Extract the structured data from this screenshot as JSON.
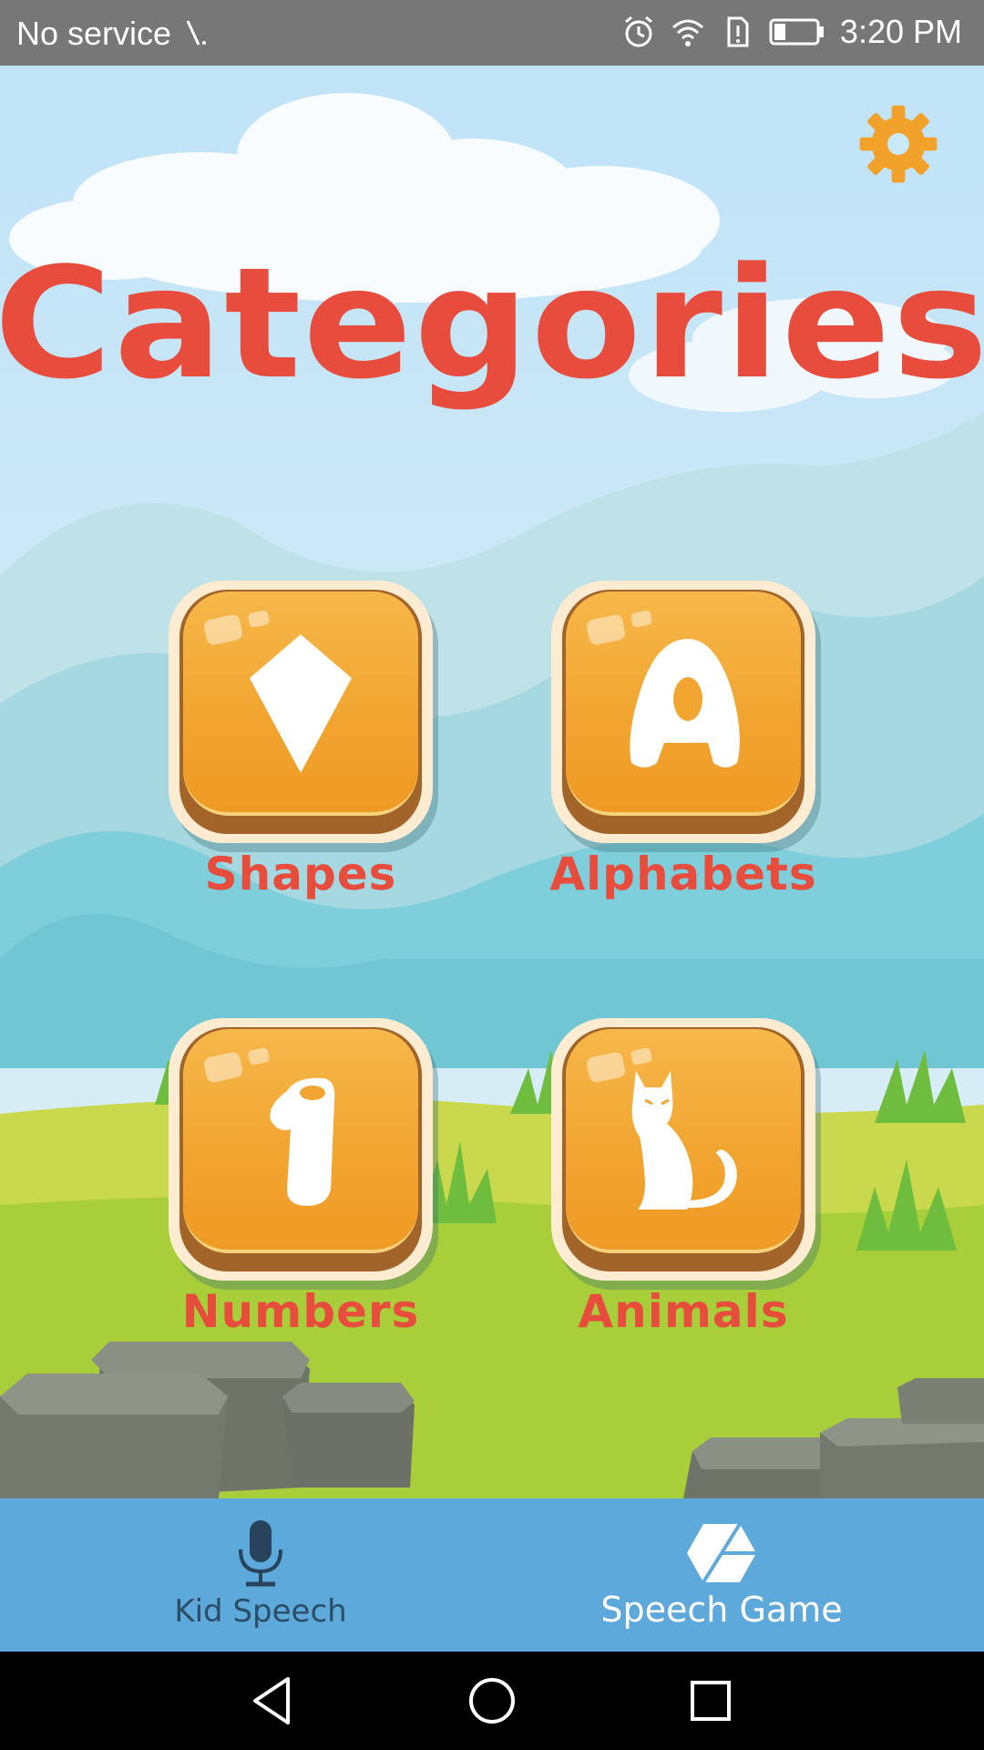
{
  "status_bar": {
    "carrier": "No service",
    "time": "3:20 PM",
    "icons": [
      "no-signal-icon",
      "alarm-icon",
      "wifi-icon",
      "sim-alert-icon",
      "battery-icon"
    ]
  },
  "screen": {
    "title": "Categories",
    "settings_icon": "gear-icon",
    "colors": {
      "title": "#e84c3d",
      "tile": "#f2a531",
      "gear": "#f2a22a",
      "nav_bar": "#5ea9db"
    }
  },
  "categories": [
    {
      "label": "Shapes",
      "icon": "diamond-icon"
    },
    {
      "label": "Alphabets",
      "icon": "letter-a-icon"
    },
    {
      "label": "Numbers",
      "icon": "number-one-icon"
    },
    {
      "label": "Animals",
      "icon": "cat-icon"
    }
  ],
  "bottom_nav": {
    "items": [
      {
        "label": "Kid Speech",
        "icon": "microphone-icon",
        "active": false
      },
      {
        "label": "Speech Game",
        "icon": "cube-icon",
        "active": true
      }
    ]
  },
  "system_nav": {
    "buttons": [
      "back-icon",
      "home-icon",
      "recents-icon"
    ]
  }
}
